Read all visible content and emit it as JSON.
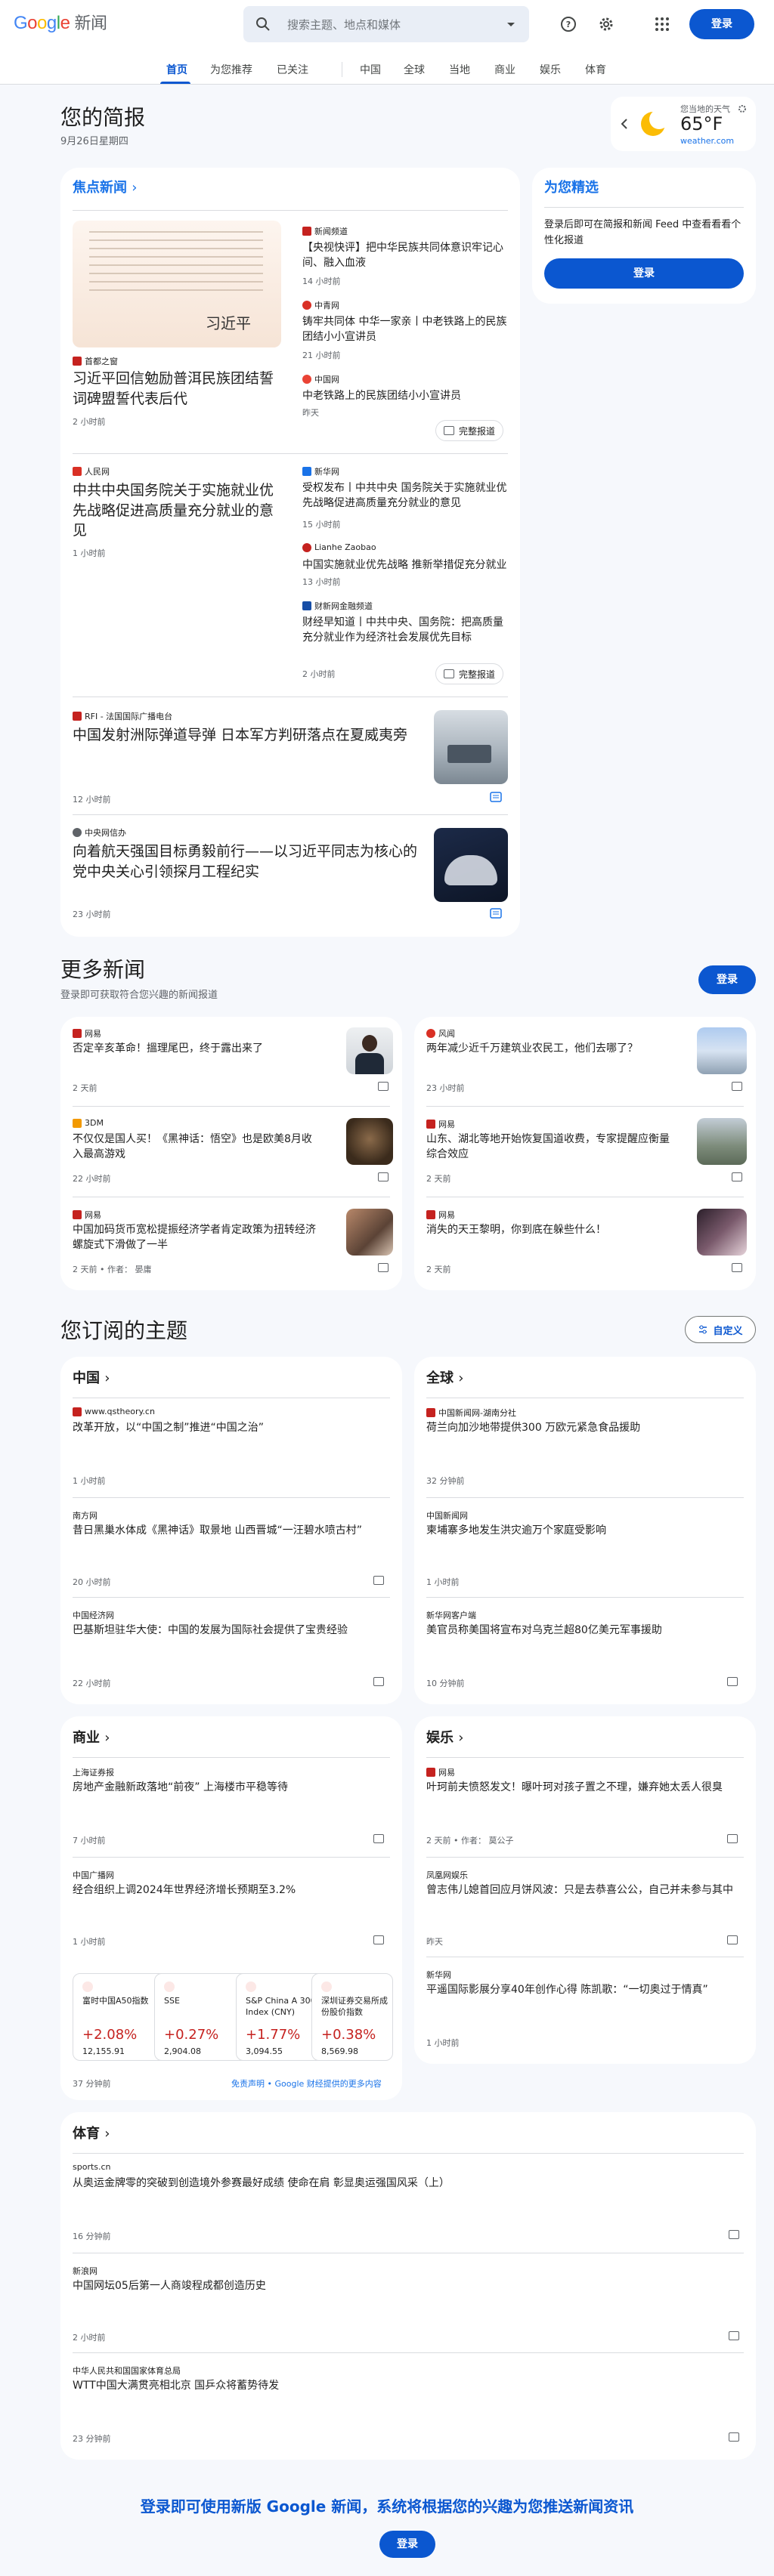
{
  "header": {
    "logo": {
      "g": "G",
      "o1": "o",
      "o2": "o",
      "g2": "g",
      "l": "l",
      "e": "e",
      "product": "新闻"
    },
    "search_placeholder": "搜索主题、地点和媒体",
    "signin": "登录"
  },
  "nav": {
    "tabs": [
      "首页",
      "为您推荐",
      "已关注",
      "中国",
      "全球",
      "当地",
      "商业",
      "娱乐",
      "体育"
    ]
  },
  "briefing": {
    "title": "您的简报",
    "date": "9月26日星期四"
  },
  "weather": {
    "label": "您当地的天气",
    "temp": "65°F",
    "source": "weather.com"
  },
  "foryou": {
    "title": "为您精选",
    "text": "登录后即可在简报和新闻 Feed 中查看看看个性化报道",
    "button": "登录"
  },
  "top": {
    "title": "焦点新闻",
    "full_coverage": "完整报道",
    "clusters": [
      {
        "source": "首都之窗",
        "headline": "习近平回信勉励普洱民族团结誓词碑盟誓代表后代",
        "time": "2 小时前",
        "image_caption": "习近平",
        "side": [
          {
            "source": "新闻频道",
            "headline": "【央视快评】把中华民族共同体意识牢记心间、融入血液",
            "time": "14 小时前"
          },
          {
            "source": "中青网",
            "headline": "铸牢共同体 中华一家亲丨中老铁路上的民族团结小小宣讲员",
            "time": "21 小时前"
          },
          {
            "source": "中国网",
            "headline": "中老铁路上的民族团结小小宣讲员",
            "time": "昨天"
          }
        ]
      },
      {
        "source": "人民网",
        "headline": "中共中央国务院关于实施就业优先战略促进高质量充分就业的意见",
        "time": "1 小时前",
        "side": [
          {
            "source": "新华网",
            "headline": "受权发布丨中共中央 国务院关于实施就业优先战略促进高质量充分就业的意见",
            "time": "15 小时前"
          },
          {
            "source": "Lianhe Zaobao",
            "headline": "中国实施就业优先战略 推新举措促充分就业",
            "time": "13 小时前"
          },
          {
            "source": "财新网金融频道",
            "headline": "财经早知道丨中共中央、国务院：把高质量充分就业作为经济社会发展优先目标",
            "time": "2 小时前"
          }
        ]
      },
      {
        "source": "RFI - 法国国际广播电台",
        "headline": "中国发射洲际弹道导弹 日本军方判研落点在夏威夷旁",
        "time": "12 小时前"
      },
      {
        "source": "中央网信办",
        "headline": "向着航天强国目标勇毅前行——以习近平同志为核心的党中央关心引领探月工程纪实",
        "time": "23 小时前"
      }
    ]
  },
  "more": {
    "title": "更多新闻",
    "subtitle": "登录即可获取符合您兴趣的新闻报道",
    "button": "登录",
    "items": [
      {
        "source": "网易",
        "headline": "否定辛亥革命！搵理尾巴，终于露出来了",
        "meta": "2 天前"
      },
      {
        "source": "风闻",
        "headline": "两年减少近千万建筑业农民工，他们去哪了？",
        "meta": "23 小时前"
      },
      {
        "source": "3DM",
        "headline": "不仅仅是国人买！《黑神话：悟空》也是欧美8月收入最高游戏",
        "meta": "22 小时前"
      },
      {
        "source": "网易",
        "headline": "山东、湖北等地开始恢复国道收费，专家提醒应衡量综合效应",
        "meta": "2 天前"
      },
      {
        "source": "网易",
        "headline": "中国加码货币宽松提振经济学者肯定政策为扭转经济螺旋式下滑做了一半",
        "meta": "2 天前 • 作者： 晏庸"
      },
      {
        "source": "网易",
        "headline": "消失的天王黎明，你到底在躲些什么！",
        "meta": "2 天前"
      }
    ]
  },
  "topics": {
    "title": "您订阅的主题",
    "customize": "自定义",
    "china": {
      "title": "中国",
      "items": [
        {
          "source": "www.qstheory.cn",
          "headline": "改革开放，以“中国之制”推进“中国之治”",
          "meta": "1 小时前"
        },
        {
          "source": "南方网",
          "headline": "昔日黑巢水体成《黑神话》取景地 山西晋城“一汪碧水喷古村”",
          "meta": "20 小时前"
        },
        {
          "source": "中国经济网",
          "headline": "巴基斯坦驻华大使：中国的发展为国际社会提供了宝贵经验",
          "meta": "22 小时前"
        }
      ]
    },
    "world": {
      "title": "全球",
      "items": [
        {
          "source": "中国新闻网-湖南分社",
          "headline": "荷兰向加沙地带提供300 万欧元紧急食品援助",
          "meta": "32 分钟前"
        },
        {
          "source": "中国新闻网",
          "headline": "柬埔寨多地发生洪灾逾万个家庭受影响",
          "meta": "1 小时前"
        },
        {
          "source": "新华网客户端",
          "headline": "美官员称美国将宣布对乌克兰超80亿美元军事援助",
          "meta": "10 分钟前"
        }
      ]
    },
    "business": {
      "title": "商业",
      "items": [
        {
          "source": "上海证券报",
          "headline": "房地产金融新政落地“前夜” 上海楼市平稳等待",
          "meta": "7 小时前"
        },
        {
          "source": "中国广播网",
          "headline": "经合组织上调2024年世界经济增长预期至3.2%",
          "meta": "1 小时前"
        }
      ],
      "stocks": [
        {
          "name": "富时中国A50指数",
          "pct": "+2.08%",
          "val": "12,155.91"
        },
        {
          "name": "SSE",
          "pct": "+0.27%",
          "val": "2,904.08"
        },
        {
          "name": "S&P China A 300 Index (CNY)",
          "pct": "+1.77%",
          "val": "3,094.55"
        },
        {
          "name": "深圳证券交易所成份股价指数",
          "pct": "+0.38%",
          "val": "8,569.98"
        }
      ],
      "time": "37 分钟前",
      "disclaimer": "免责声明 • Google 财经提供的更多内容"
    },
    "ent": {
      "title": "娱乐",
      "items": [
        {
          "source": "网易",
          "headline": "叶珂前夫愤怒发文！曝叶珂对孩子置之不理，嫌弃她太丢人很臭",
          "meta": "2 天前 • 作者： 莫公子"
        },
        {
          "source": "凤凰网娱乐",
          "headline": "曾志伟儿媳首回应月饼风波：只是去恭喜公公，自己并未参与其中",
          "meta": "昨天"
        },
        {
          "source": "新华网",
          "headline": "平遥国际影展分享40年创作心得 陈凯歌：“一切奥过于情真”",
          "meta": "1 小时前"
        }
      ]
    },
    "sports": {
      "title": "体育",
      "items": [
        {
          "source": "sports.cn",
          "headline": "从奥运金牌零的突破到创造境外参赛最好成绩 使命在肩 彰显奥运强国风采（上）",
          "meta": "16 分钟前"
        },
        {
          "source": "新浪网",
          "headline": "中国网坛05后第一人商竣程成都创造历史",
          "meta": "2 小时前"
        },
        {
          "source": "中华人民共和国国家体育总局",
          "headline": "WTT中国大满贯亮相北京 国乒众将蓄势待发",
          "meta": "23 分钟前"
        }
      ]
    }
  },
  "footer": {
    "text": "登录即可使用新版 Google 新闻，系统将根据您的兴趣为您推送新闻资讯",
    "button": "登录"
  }
}
